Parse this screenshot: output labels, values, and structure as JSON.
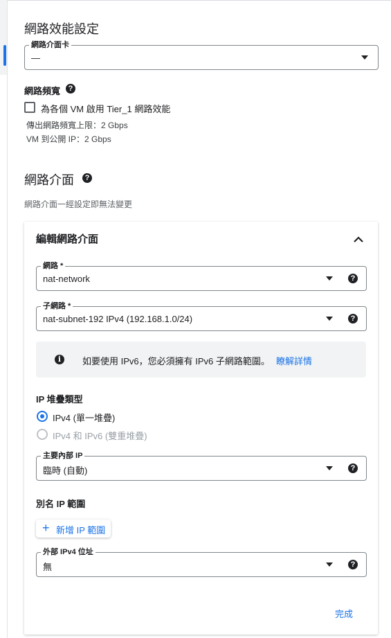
{
  "performance": {
    "title": "網路效能設定",
    "nic": {
      "label": "網路介面卡",
      "value": "—"
    },
    "bandwidth": {
      "label": "網路頻寬",
      "help_icon": "help-icon",
      "checkbox_label": "為各個 VM 啟用 Tier_1 網路效能",
      "checked": false,
      "egress_text": "傳出網路頻寬上限：2 Gbps",
      "public_ip_text": "VM 到公開 IP：2 Gbps"
    }
  },
  "interfaces": {
    "title": "網路介面",
    "help_icon": "help-icon",
    "subtitle": "網路介面一經設定即無法變更"
  },
  "edit_card": {
    "title": "編輯網路介面",
    "collapse_icon": "chevron-up-icon",
    "network": {
      "label": "網路 *",
      "value": "nat-network"
    },
    "subnet": {
      "label": "子網路 *",
      "value": "nat-subnet-192 IPv4 (192.168.1.0/24)"
    },
    "info": {
      "icon": "info-icon",
      "text": "如要使用 IPv6，您必須擁有 IPv6 子網路範圍。",
      "link": "瞭解詳情"
    },
    "stack_type": {
      "label": "IP 堆疊類型",
      "options": [
        {
          "label": "IPv4 (單一堆疊)",
          "selected": true,
          "enabled": true
        },
        {
          "label": "IPv4 和 IPv6 (雙重堆疊)",
          "selected": false,
          "enabled": false
        }
      ]
    },
    "internal_ip": {
      "label": "主要內部 IP",
      "value": "臨時 (自動)"
    },
    "alias": {
      "label": "別名 IP 範圍",
      "add_button": "新增 IP 範圍",
      "add_icon": "plus-icon"
    },
    "external_ip": {
      "label": "外部 IPv4 位址",
      "value": "無"
    },
    "done_button": "完成"
  },
  "colors": {
    "accent": "#1a73e8",
    "text": "#202124",
    "info_bg": "#f1f3f4"
  }
}
